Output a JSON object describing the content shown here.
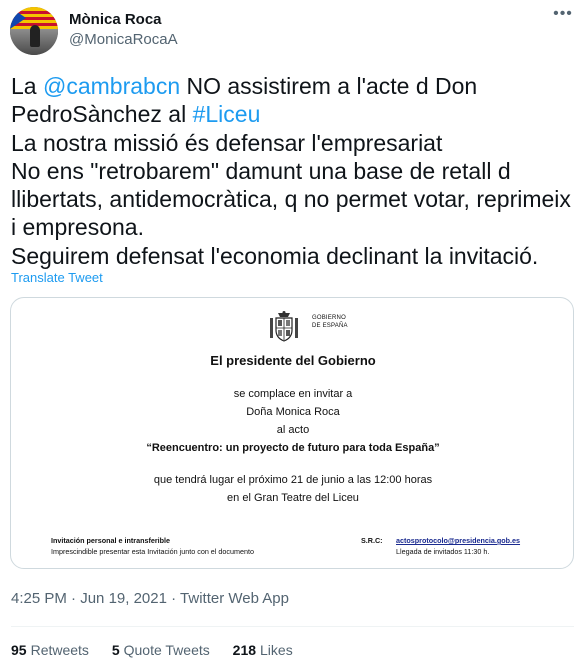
{
  "author": {
    "name": "Mònica Roca",
    "handle": "@MonicaRocaA"
  },
  "more_icon": "more-horizontal-icon",
  "tweet": {
    "lines": [
      {
        "parts": [
          {
            "t": "La "
          },
          {
            "t": "@cambrabcn",
            "link": true
          },
          {
            "t": " NO assistirem a l'acte d Don"
          }
        ]
      },
      {
        "parts": [
          {
            "t": "PedroSànchez al "
          },
          {
            "t": "#Liceu",
            "link": true
          }
        ]
      },
      {
        "parts": [
          {
            "t": "La nostra missió és defensar l'empresariat"
          }
        ]
      },
      {
        "parts": [
          {
            "t": "No ens \"retrobarem\" damunt una base de retall d"
          }
        ]
      },
      {
        "parts": [
          {
            "t": "llibertats, antidemocràtica, q no permet votar, reprimeix"
          }
        ]
      },
      {
        "parts": [
          {
            "t": "i empresona."
          }
        ]
      },
      {
        "parts": [
          {
            "t": "Seguirem defensat l'economia declinant la invitació."
          }
        ]
      }
    ],
    "translate_label": "Translate Tweet"
  },
  "invitation": {
    "issuer_line1": "GOBIERNO",
    "issuer_line2": "DE ESPAÑA",
    "heading": "El presidente del Gobierno",
    "line1": "se complace en invitar a",
    "line2": "Doña Monica Roca",
    "line3": "al acto",
    "event": "“Reencuentro: un proyecto de futuro para toda España”",
    "line4": "que tendrá lugar el próximo 21 de junio a las 12:00 horas",
    "line5": "en el Gran Teatre del Liceu",
    "foot_left_bold": "Invitación personal e intransferible",
    "foot_left": "Imprescindible presentar esta Invitación junto con el documento",
    "src_label": "S.R.C:",
    "src_email": "actosprotocolo@presidencia.gob.es",
    "arrival": "Llegada de invitados 11:30 h."
  },
  "meta": {
    "time": "4:25 PM",
    "date": "Jun 19, 2021",
    "source": "Twitter Web App"
  },
  "stats": {
    "retweets_count": "95",
    "retweets_label": "Retweets",
    "quotes_count": "5",
    "quotes_label": "Quote Tweets",
    "likes_count": "218",
    "likes_label": "Likes"
  },
  "colors": {
    "link": "#1d9bf0",
    "muted": "#536471",
    "text": "#0f1419",
    "border": "#cfd9de"
  }
}
